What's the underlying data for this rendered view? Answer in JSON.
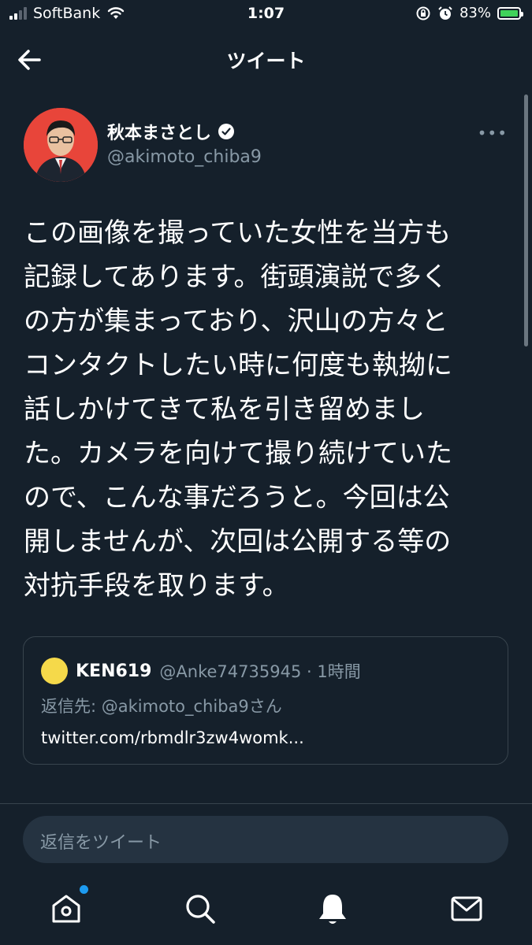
{
  "status_bar": {
    "carrier": "SoftBank",
    "time": "1:07",
    "battery": "83%",
    "battery_level": 0.83,
    "icons": [
      "signal-icon",
      "wifi-icon",
      "orientation-lock-icon",
      "alarm-icon",
      "battery-charging-icon"
    ]
  },
  "header": {
    "back_icon": "back-arrow-icon",
    "title": "ツイート"
  },
  "tweet": {
    "author_name": "秋本まさとし",
    "handle": "@akimoto_chiba9",
    "verified_icon": "verified-badge-icon",
    "more": "•••",
    "lines": [
      "この画像を撮っていた女性を当方も",
      "記録してあります。街頭演説で多く",
      "の方が集まっており、沢山の方々と",
      "コンタクトしたい時に何度も執拗に",
      "話しかけてきて私を引き留めまし",
      "た。カメラを向けて撮り続けていた",
      "ので、こんな事だろうと。今回は公",
      "開しませんが、次回は公開する等の",
      "対抗手段を取ります。"
    ]
  },
  "quoted": {
    "name": "KEN619",
    "handle_time": "@Anke74735945 · 1時間",
    "reply_to": "返信先: @akimoto_chiba9さん",
    "link": "twitter.com/rbmdlr3zw4womk..."
  },
  "reply": {
    "placeholder": "返信をツイート"
  },
  "tabbar": {
    "items": [
      "home-icon",
      "search-icon",
      "notifications-icon",
      "messages-icon"
    ],
    "colors": {
      "accent": "#1d9bf0",
      "background": "#15202b",
      "muted": "#8899a6"
    }
  }
}
